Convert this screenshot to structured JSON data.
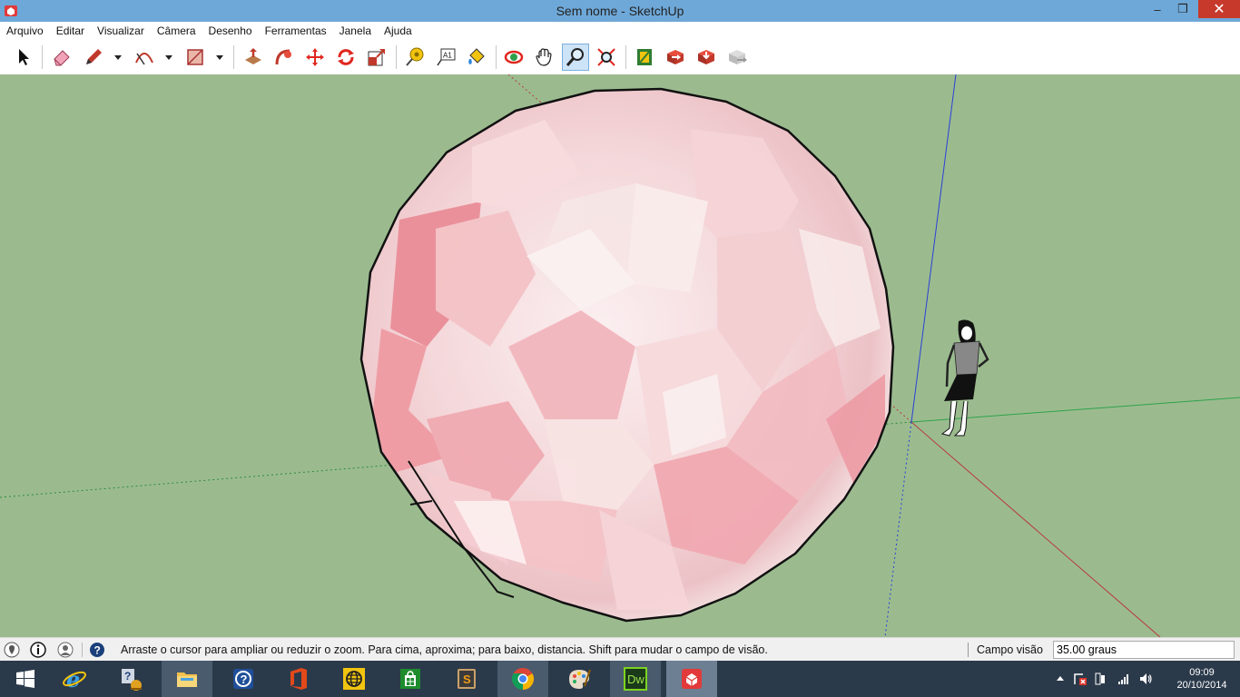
{
  "window": {
    "title": "Sem nome - SketchUp",
    "minimize": "–",
    "maximize": "❒",
    "close": "✕"
  },
  "menu": [
    "Arquivo",
    "Editar",
    "Visualizar",
    "Câmera",
    "Desenho",
    "Ferramentas",
    "Janela",
    "Ajuda"
  ],
  "toolbar": {
    "tools": [
      "select",
      "eraser",
      "pencil",
      "arc",
      "rectangle",
      "push-pull",
      "follow-me",
      "move",
      "rotate",
      "scale",
      "tape-measure",
      "text",
      "paint-bucket",
      "orbit",
      "pan",
      "zoom",
      "zoom-extents",
      "warehouse",
      "share-model",
      "get-models",
      "extension-warehouse"
    ],
    "active_tool": "zoom"
  },
  "status": {
    "message": "Arraste o cursor para ampliar ou reduzir o zoom. Para cima, aproxima; para baixo, distancia. Shift para mudar o campo de visão.",
    "vcb_label": "Campo visão",
    "vcb_value": "35.00 graus"
  },
  "taskbar": {
    "apps": [
      "windows-start",
      "internet-explorer",
      "help-desk",
      "file-explorer",
      "help",
      "office",
      "globe",
      "store",
      "sublime",
      "chrome",
      "paint",
      "dreamweaver",
      "sketchup"
    ],
    "dreamweaver_label": "Dw",
    "time": "09:09",
    "date": "20/10/2014"
  },
  "colors": {
    "sky_ground": "#9bbb8f",
    "titlebar": "#6ea8d8",
    "close": "#c7392b",
    "taskbar": "#2b3a4a"
  }
}
